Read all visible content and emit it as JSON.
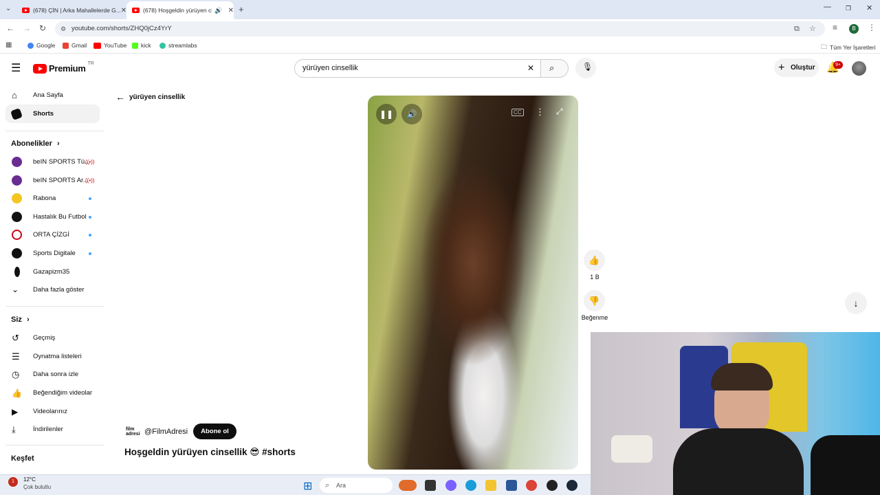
{
  "browser": {
    "tabs": [
      {
        "title": "(678) ÇİN | Arka Mahallelerde G...",
        "active": false
      },
      {
        "title": "(678) Hoşgeldin yürüyen ci...",
        "active": true
      }
    ],
    "url": "youtube.com/shorts/ZHQ0jCz4YrY",
    "profile_initial": "B",
    "bookmarks": [
      "Google",
      "Gmail",
      "YouTube",
      "kick",
      "streamlabs"
    ],
    "all_bookmarks": "Tüm Yer İşaretleri"
  },
  "header": {
    "logo": "Premium",
    "region": "TR",
    "search_value": "yürüyen cinsellik",
    "create_label": "Oluştur",
    "notif_badge": "9+"
  },
  "sidebar": {
    "main": [
      {
        "label": "Ana Sayfa",
        "icon": "home-icon"
      },
      {
        "label": "Shorts",
        "icon": "shorts-icon",
        "selected": true
      }
    ],
    "subs_title": "Abonelikler",
    "subs": [
      {
        "label": "beIN SPORTS Tü...",
        "live": true,
        "color": "#6a2c91"
      },
      {
        "label": "beIN SPORTS Ar...",
        "live": true,
        "color": "#6a2c91"
      },
      {
        "label": "Rabona",
        "dot": true,
        "color": "#f3c623"
      },
      {
        "label": "Hastalık Bu Futbol",
        "dot": true,
        "color": "#111111"
      },
      {
        "label": "ORTA ÇİZGİ",
        "dot": true,
        "color": "#d0021b"
      },
      {
        "label": "Sports Digitale",
        "dot": true,
        "color": "#111111"
      },
      {
        "label": "Gazapizm35",
        "dot": false,
        "color": "#111111"
      },
      {
        "label": "Daha fazla göster",
        "dot": false,
        "color": ""
      }
    ],
    "you_title": "Siz",
    "you": [
      {
        "label": "Geçmiş",
        "icon": "history-icon"
      },
      {
        "label": "Oynatma listeleri",
        "icon": "playlist-icon"
      },
      {
        "label": "Daha sonra izle",
        "icon": "clock-icon"
      },
      {
        "label": "Beğendiğim videolar",
        "icon": "thumbs-up-icon"
      },
      {
        "label": "Videolarınız",
        "icon": "video-icon"
      },
      {
        "label": "İndirilenler",
        "icon": "download-icon"
      }
    ],
    "explore_title": "Keşfet"
  },
  "main": {
    "back_label": "yürüyen cinsellik",
    "channel": "@FilmAdresi",
    "channel_avatar_text": "film adresi",
    "subscribe_label": "Abone ol",
    "title": "Hoşgeldin yürüyen cinsellik 😎 #shorts",
    "likes": "1 B",
    "dislike_label": "Beğenme"
  },
  "taskbar": {
    "weather_temp": "12°C",
    "weather_desc": "Çok bulutlu",
    "search_placeholder": "Ara"
  }
}
